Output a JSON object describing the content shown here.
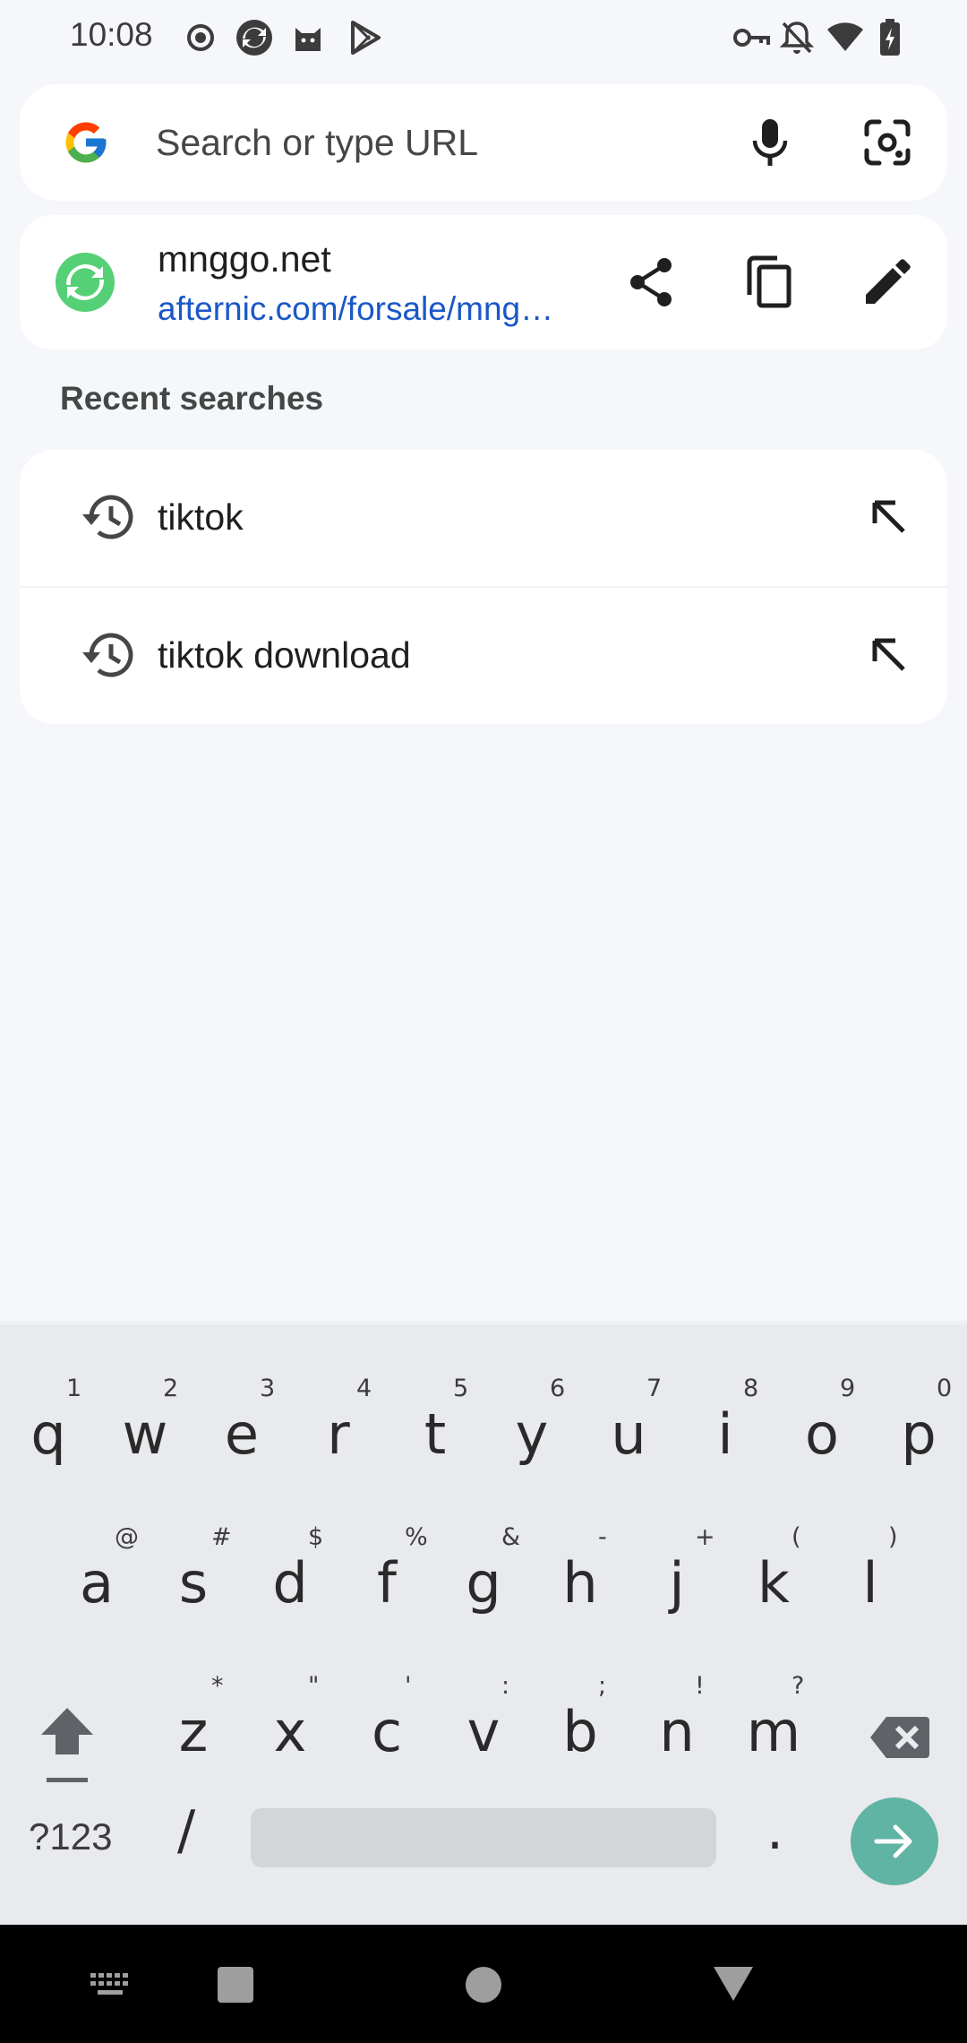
{
  "status_bar": {
    "time": "10:08",
    "left_icons": [
      "record-icon",
      "browser-app-icon",
      "cat-app-icon",
      "play-store-icon"
    ],
    "right_icons": [
      "vpn-key-icon",
      "notifications-off-icon",
      "wifi-icon",
      "battery-charging-icon"
    ]
  },
  "omnibox": {
    "placeholder": "Search or type URL",
    "logo": "google-g-icon",
    "buttons": [
      "mic-icon",
      "lens-icon"
    ]
  },
  "current_page": {
    "title": "mnggo.net",
    "url": "afternic.com/forsale/mng…",
    "favicon": "refresh-favicon",
    "actions": [
      "share-icon",
      "copy-icon",
      "edit-icon"
    ]
  },
  "recent": {
    "title": "Recent searches",
    "items": [
      {
        "label": "tiktok"
      },
      {
        "label": "tiktok download"
      }
    ]
  },
  "keyboard": {
    "row1": [
      {
        "k": "q",
        "h": "1"
      },
      {
        "k": "w",
        "h": "2"
      },
      {
        "k": "e",
        "h": "3"
      },
      {
        "k": "r",
        "h": "4"
      },
      {
        "k": "t",
        "h": "5"
      },
      {
        "k": "y",
        "h": "6"
      },
      {
        "k": "u",
        "h": "7"
      },
      {
        "k": "i",
        "h": "8"
      },
      {
        "k": "o",
        "h": "9"
      },
      {
        "k": "p",
        "h": "0"
      }
    ],
    "row2": [
      {
        "k": "a",
        "h": "@"
      },
      {
        "k": "s",
        "h": "#"
      },
      {
        "k": "d",
        "h": "$"
      },
      {
        "k": "f",
        "h": "%"
      },
      {
        "k": "g",
        "h": "&"
      },
      {
        "k": "h",
        "h": "-"
      },
      {
        "k": "j",
        "h": "+"
      },
      {
        "k": "k",
        "h": "("
      },
      {
        "k": "l",
        "h": ")"
      }
    ],
    "row3": [
      {
        "k": "z",
        "h": "*"
      },
      {
        "k": "x",
        "h": "\""
      },
      {
        "k": "c",
        "h": "'"
      },
      {
        "k": "v",
        "h": ":"
      },
      {
        "k": "b",
        "h": ";"
      },
      {
        "k": "n",
        "h": "!"
      },
      {
        "k": "m",
        "h": "?"
      }
    ],
    "symbols_label": "?123",
    "slash_label": "/",
    "period_label": ".",
    "accent_color": "#5fb4a4"
  },
  "nav_bar": {
    "buttons": [
      "keyboard-switch-icon",
      "recents-icon",
      "home-icon",
      "back-icon"
    ]
  }
}
